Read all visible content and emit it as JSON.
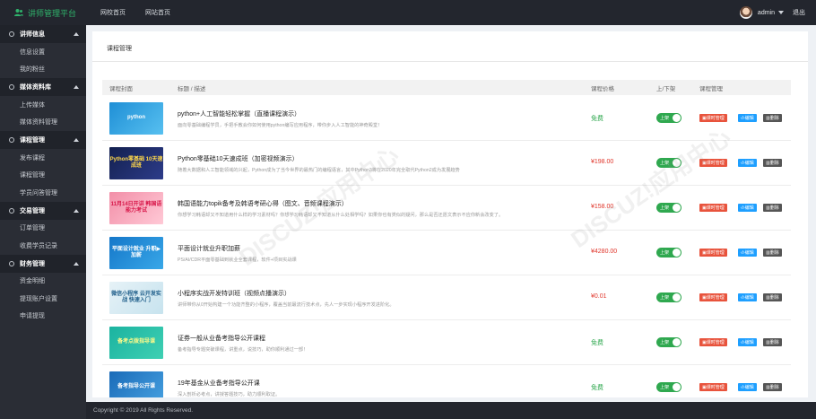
{
  "brand": {
    "title": "讲师管理平台"
  },
  "topnav": [
    "网校首页",
    "网站首页"
  ],
  "user": {
    "name": "admin",
    "logout": "退出"
  },
  "sidebar": [
    {
      "label": "讲师信息",
      "items": [
        "信息设置",
        "我的粉丝"
      ]
    },
    {
      "label": "媒体资料库",
      "items": [
        "上传媒体",
        "媒体资料管理"
      ]
    },
    {
      "label": "课程管理",
      "items": [
        "发布课程",
        "课程管理",
        "学员问答管理"
      ]
    },
    {
      "label": "交易管理",
      "items": [
        "订单管理",
        "收费学员记录"
      ]
    },
    {
      "label": "财务管理",
      "items": [
        "资金明细",
        "提现账户设置",
        "申请提现"
      ]
    }
  ],
  "page": {
    "title": "课程管理"
  },
  "table": {
    "headers": [
      "课程封面",
      "标题 / 描述",
      "课程价格",
      "上/下架",
      "课程管理"
    ],
    "status_label": "上架",
    "btn_manage": "课时管理",
    "btn_edit": "编辑",
    "btn_delete": "删除",
    "rows": [
      {
        "cover": "python",
        "title": "python+人工智能轻松掌握（直播课程演示）",
        "desc": "面向零基础编程学员，手把手教会你如何使用python编写应用程序，带你步入人工智能的神奇殿堂！",
        "price": "免费",
        "free": true
      },
      {
        "cover": "Python零基础 10天速成班",
        "title": "Python零基础10天速成班（加密视频演示）",
        "desc": "随着大数据和人工智能领域的兴起，Python成为了当今世界的最热门的编程语言，其中Python3将在2020年完全取代Python2成为发展趋势",
        "price": "¥198.00",
        "free": false
      },
      {
        "cover": "11月14日开讲 韩国语能力考试",
        "title": "韩国语能力topik备考及韩语考研心得（图文、音频课程演示）",
        "desc": "你想学习韩语却又不知道用什么样的学习素材吗？你想学习韩语却又不知道从什么处相学吗？如果你也有类似的疑问，那么是否还愿文表示不应你新会改变了。",
        "price": "¥158.00",
        "free": false
      },
      {
        "cover": "平面设计就业 升职▶加薪",
        "title": "平面设计就业升职加薪",
        "desc": "PS/AI/CDR平面零基础到就业全套课程，软件+项目实战课",
        "price": "¥4280.00",
        "free": false
      },
      {
        "cover": "微信小程序 云开发实战 快速入门",
        "title": "小程序实战开发特训班（视频点播演示）",
        "desc": "讲师带你从0开始构建一个功能齐整的小程序，覆盖当前最流行技术点，先人一步实现小程序开发进阶化。",
        "price": "¥0.01",
        "free": false
      },
      {
        "cover": "备考点拨指导课",
        "title": "证券一般从业备考指导公开课程",
        "desc": "备考指导专题突破课程，讲重点，说技巧，助你顺利通过一部！",
        "price": "免费",
        "free": true
      },
      {
        "cover": "备考指导公开课",
        "title": "19年基金从业备考指导公开课",
        "desc": "深入剖析必考点，讲授答题技巧，助力顺利取证。",
        "price": "免费",
        "free": true
      }
    ]
  },
  "footer": {
    "copyright": "Copyright © 2019 All Rights Reserved."
  },
  "colors": {
    "topbar": "#23262e",
    "sidebar": "#2a2d35",
    "brand": "#2fb36b",
    "free": "#2fa84f",
    "paid": "#e0362b",
    "manage": "#e8533c",
    "edit": "#1e9fff",
    "delete": "#555555"
  }
}
